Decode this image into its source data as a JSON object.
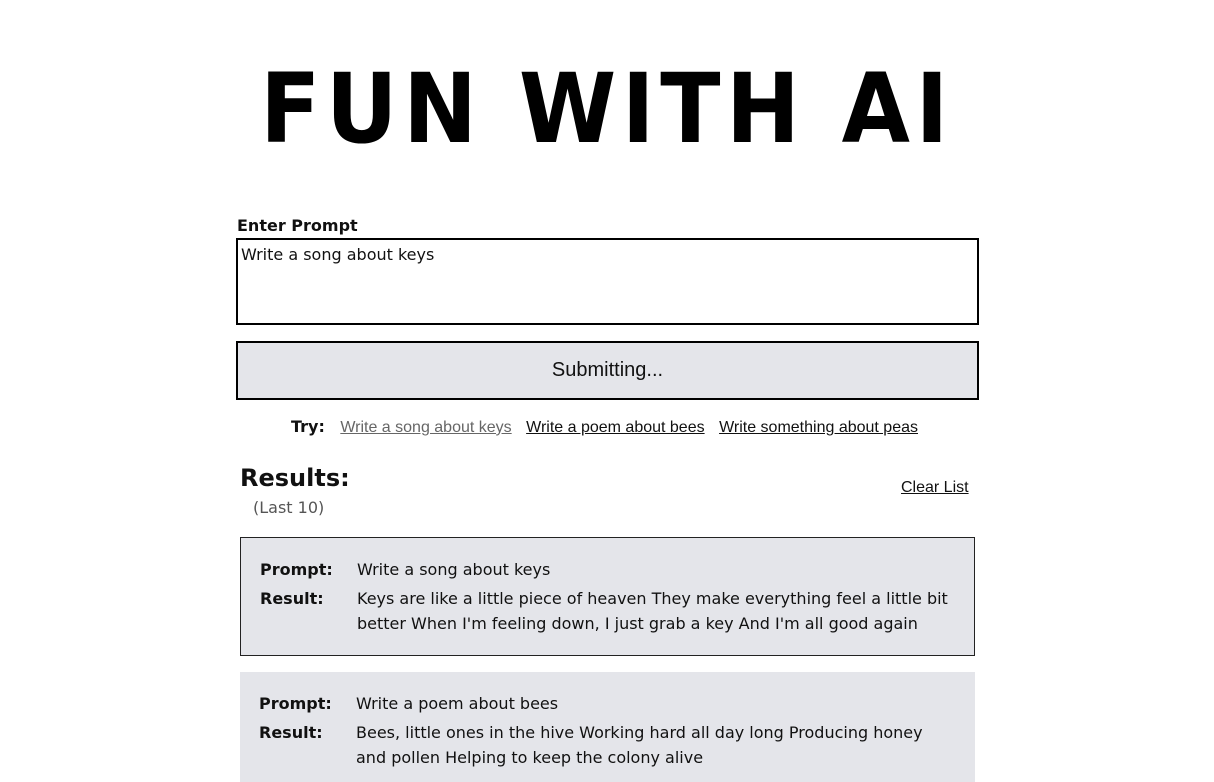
{
  "header": {
    "title": "FUN WITH AI"
  },
  "form": {
    "prompt_label": "Enter Prompt",
    "prompt_value": "Write a song about keys",
    "submit_label": "Submitting..."
  },
  "try": {
    "label": "Try:",
    "suggestions": [
      "Write a song about keys",
      "Write a poem about bees",
      "Write something about peas"
    ]
  },
  "results": {
    "heading": "Results:",
    "subheading": "(Last 10)",
    "clear_label": "Clear List",
    "prompt_label": "Prompt:",
    "result_label": "Result:",
    "items": [
      {
        "prompt": "Write a song about keys",
        "result": "Keys are like a little piece of heaven They make everything feel a little bit better When I'm feeling down, I just grab a key And I'm all good again"
      },
      {
        "prompt": "Write a poem about bees",
        "result": "Bees, little ones in the hive Working hard all day long Producing honey and pollen Helping to keep the colony alive"
      }
    ]
  }
}
